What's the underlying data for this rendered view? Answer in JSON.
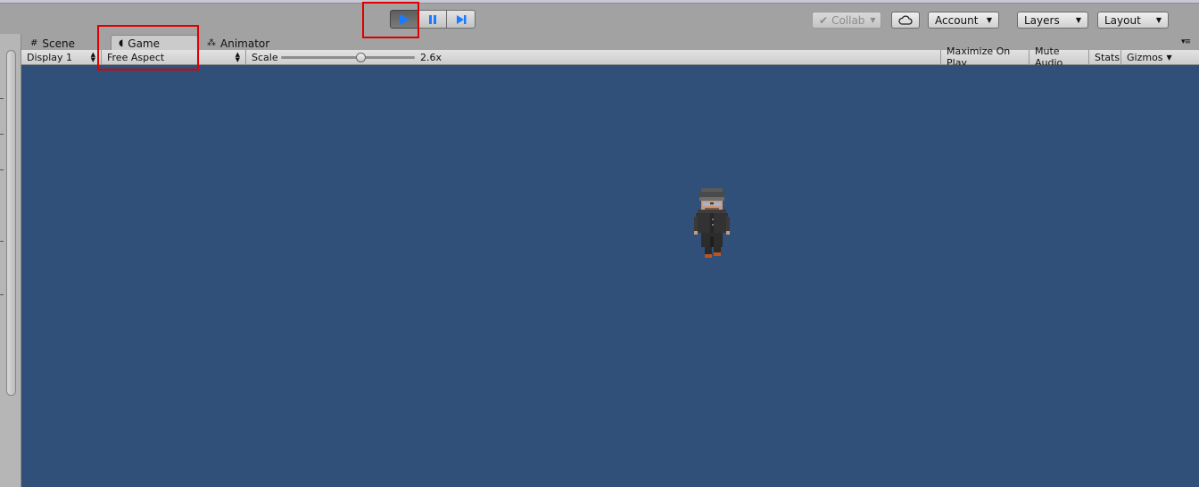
{
  "toolbar": {
    "play_label": "Play",
    "pause_label": "Pause",
    "step_label": "Step",
    "collab_label": "Collab",
    "account_label": "Account",
    "layers_label": "Layers",
    "layout_label": "Layout"
  },
  "tabs": [
    {
      "label": "Scene",
      "icon": "grid-icon"
    },
    {
      "label": "Game",
      "icon": "game-pacman-icon"
    },
    {
      "label": "Animator",
      "icon": "animator-icon"
    }
  ],
  "gamebar": {
    "display": "Display 1",
    "aspect": "Free Aspect",
    "scale_label": "Scale",
    "scale_value": "2.6x",
    "scale_fraction": 0.59,
    "maximize": "Maximize On Play",
    "mute": "Mute Audio",
    "stats": "Stats",
    "gizmos": "Gizmos"
  },
  "colors": {
    "viewport_bg": "#304f79",
    "play_icon": "#1a7bff",
    "highlight": "#e00000"
  }
}
